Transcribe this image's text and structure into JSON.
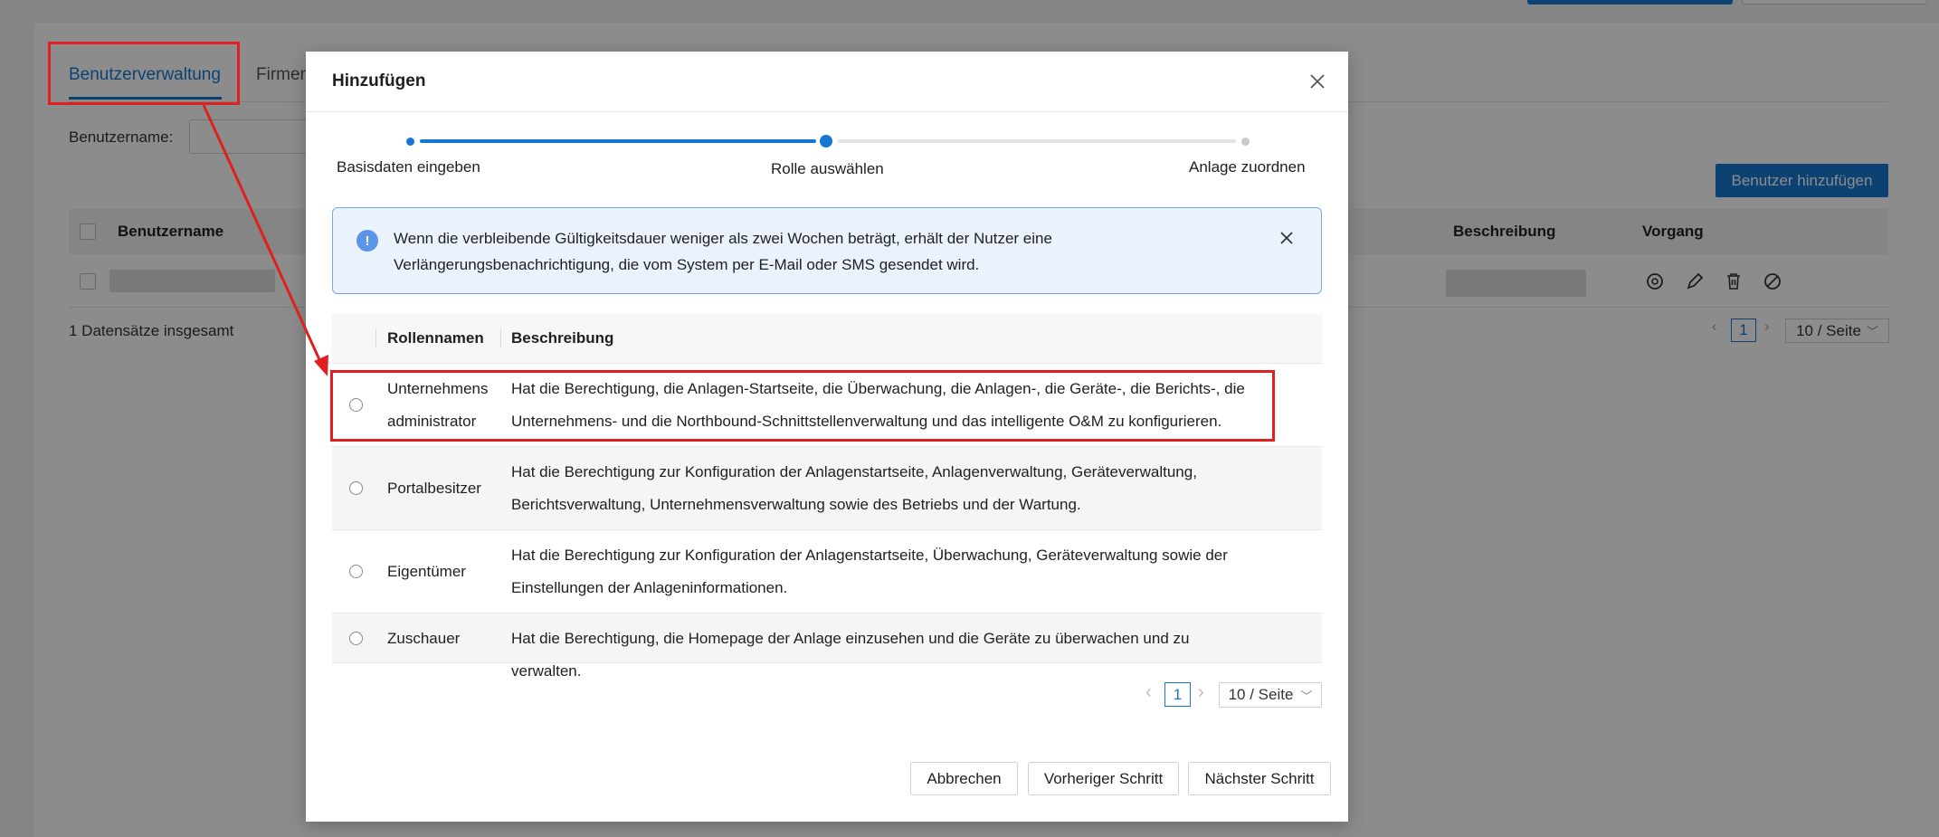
{
  "background": {
    "tabs": [
      {
        "label": "Benutzerverwaltung",
        "active": true
      },
      {
        "label": "Firmen"
      }
    ],
    "filter_label": "Benutzername:",
    "add_user_button": "Benutzer hinzufügen",
    "table_headers": {
      "username": "Benutzername",
      "description": "Beschreibung",
      "action": "Vorgang"
    },
    "total_text": "1 Datensätze insgesamt",
    "current_page": "1",
    "page_size": "10 / Seite"
  },
  "modal": {
    "title": "Hinzufügen",
    "steps": [
      {
        "label": "Basisdaten eingeben",
        "state": "done"
      },
      {
        "label": "Rolle auswählen",
        "state": "current"
      },
      {
        "label": "Anlage zuordnen",
        "state": "pending"
      }
    ],
    "alert": {
      "text": "Wenn die verbleibende Gültigkeitsdauer weniger als zwei Wochen beträgt, erhält der Nutzer eine Verlängerungsbenachrichtigung, die vom System per E-Mail oder SMS gesendet wird."
    },
    "role_table": {
      "headers": {
        "name": "Rollennamen",
        "description": "Beschreibung"
      },
      "rows": [
        {
          "name": "Unternehmens administrator",
          "description": "Hat die Berechtigung, die Anlagen-Startseite, die Überwachung, die Anlagen-, die Geräte-, die Berichts-, die Unternehmens- und die Northbound-Schnittstellenverwaltung und das intelligente O&M zu konfigurieren."
        },
        {
          "name": "Portalbesitzer",
          "description": "Hat die Berechtigung zur Konfiguration der Anlagenstartseite, Anlagenverwaltung, Geräteverwaltung, Berichtsverwaltung, Unternehmensverwaltung sowie des Betriebs und der Wartung."
        },
        {
          "name": "Eigentümer",
          "description": "Hat die Berechtigung zur Konfiguration der Anlagenstartseite, Überwachung, Geräteverwaltung sowie der Einstellungen der Anlageninformationen."
        },
        {
          "name": "Zuschauer",
          "description": "Hat die Berechtigung, die Homepage der Anlage einzusehen und die Geräte zu überwachen und zu verwalten."
        }
      ]
    },
    "pager": {
      "current_page": "1",
      "page_size": "10 / Seite"
    },
    "buttons": {
      "cancel": "Abbrechen",
      "previous": "Vorheriger Schritt",
      "next": "Nächster Schritt"
    }
  },
  "colors": {
    "primary": "#1677d2",
    "annotation": "#e02020",
    "alert_bg": "#eaf2fd"
  },
  "icons": [
    "close-icon",
    "info-icon",
    "reset-password-icon",
    "edit-icon",
    "delete-icon",
    "disable-icon",
    "chevron-left-icon",
    "chevron-right-icon",
    "chevron-down-icon"
  ]
}
